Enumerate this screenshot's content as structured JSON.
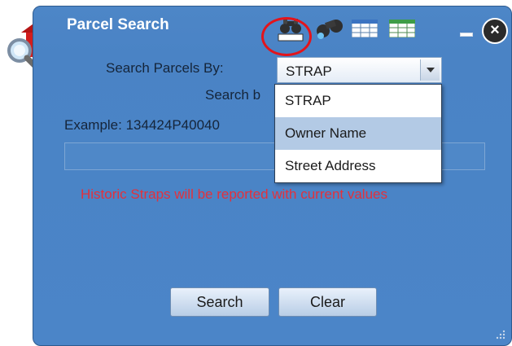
{
  "window": {
    "title": "Parcel Search",
    "close_glyph": "×",
    "icons": [
      "house-search-icon",
      "binoculars-icon",
      "binoculars-select-icon",
      "table-icon",
      "table-grid-icon"
    ]
  },
  "form": {
    "search_by_label": "Search Parcels By:",
    "selected_option": "STRAP",
    "search_by_partial": "Search b",
    "example_text": "Example: 134424P40040",
    "input_value": "",
    "warning": "Historic Straps will be reported with current values"
  },
  "dropdown": {
    "options": [
      "STRAP",
      "Owner Name",
      "Street Address"
    ],
    "highlighted": "Owner Name"
  },
  "buttons": {
    "search": "Search",
    "clear": "Clear"
  },
  "colors": {
    "panel": "#4a83c5",
    "warning": "#e2313c",
    "annotation_circle": "#e3141b"
  }
}
